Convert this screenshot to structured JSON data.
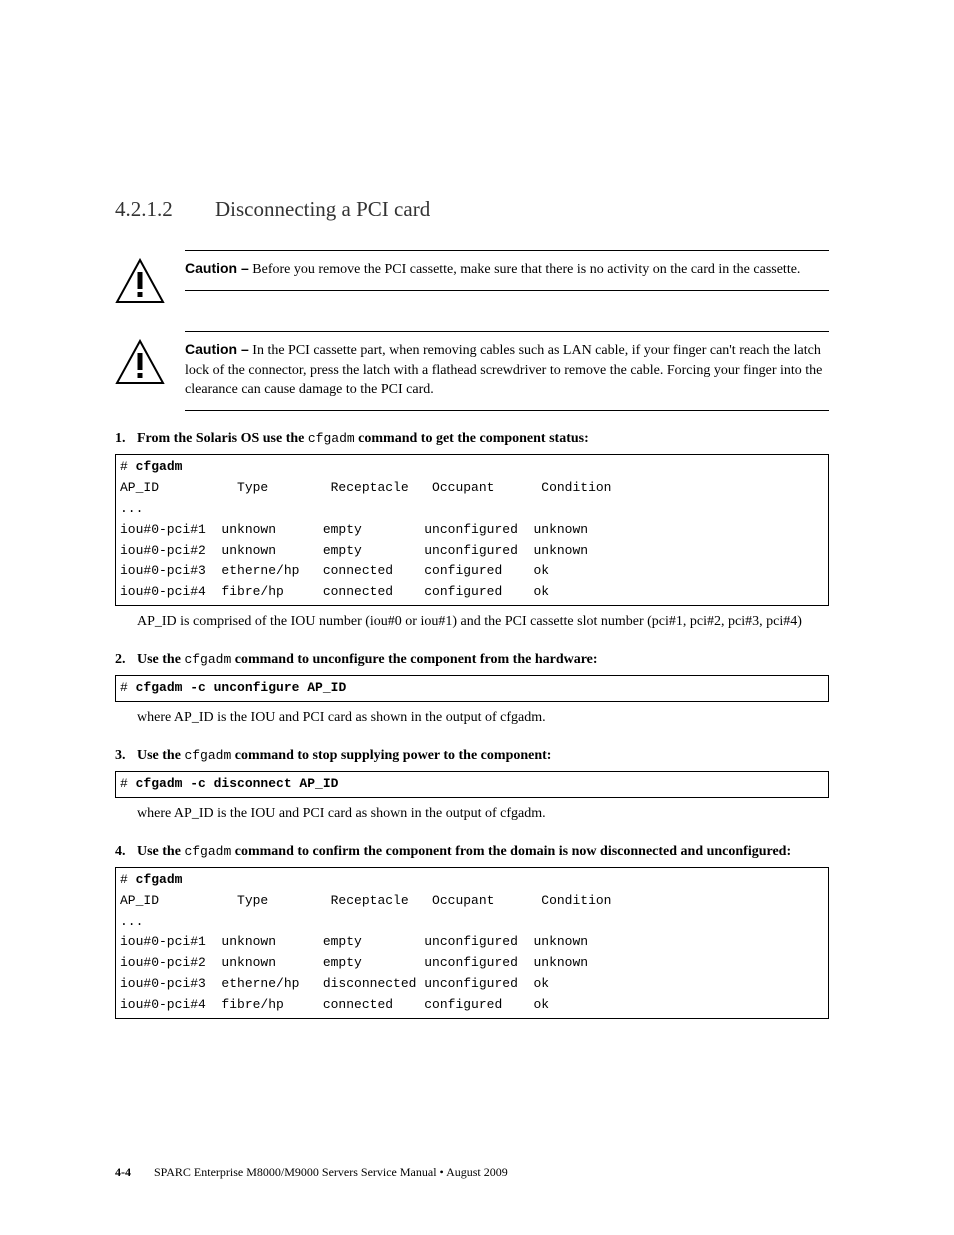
{
  "section": {
    "number": "4.2.1.2",
    "title": "Disconnecting a PCI card"
  },
  "cautions": [
    {
      "label": "Caution –",
      "text": "Before you remove the PCI cassette, make sure that there is no activity on the card in the cassette."
    },
    {
      "label": "Caution –",
      "text": "In the PCI cassette part, when removing cables such as LAN cable, if your finger can't reach the latch lock of the connector, press the latch with a flathead screwdriver to remove the cable. Forcing your finger into the clearance can cause damage to the PCI card."
    }
  ],
  "steps": [
    {
      "num": "1.",
      "pre": "From the Solaris OS use the ",
      "cmd": "cfgadm",
      "post": " command to get the component status:"
    },
    {
      "num": "2.",
      "pre": "Use the ",
      "cmd": "cfgadm",
      "post": " command to unconfigure the component from the hardware:"
    },
    {
      "num": "3.",
      "pre": "Use the ",
      "cmd": "cfgadm",
      "post": " command to stop supplying power to the component:"
    },
    {
      "num": "4.",
      "pre": "Use the ",
      "cmd": "cfgadm",
      "post": " command to confirm the component from the domain is now disconnected and unconfigured:"
    }
  ],
  "code1": {
    "prompt": "# ",
    "cmd": "cfgadm",
    "header": "AP_ID          Type        Receptacle   Occupant      Condition",
    "ellipsis": "...",
    "rows": [
      "iou#0-pci#1  unknown      empty        unconfigured  unknown",
      "iou#0-pci#2  unknown      empty        unconfigured  unknown",
      "iou#0-pci#3  etherne/hp   connected    configured    ok",
      "iou#0-pci#4  fibre/hp     connected    configured    ok"
    ]
  },
  "note1": "AP_ID is comprised of the IOU number (iou#0 or iou#1) and the PCI cassette slot number (pci#1, pci#2, pci#3, pci#4)",
  "code2": {
    "prompt": "# ",
    "cmd": "cfgadm -c unconfigure AP_ID"
  },
  "note2": "where AP_ID is the IOU and PCI card as shown in the output of cfgadm.",
  "code3": {
    "prompt": "# ",
    "cmd": "cfgadm -c disconnect AP_ID"
  },
  "note3": "where AP_ID is the IOU and PCI card as shown in the output of cfgadm.",
  "code4": {
    "prompt": "# ",
    "cmd": "cfgadm",
    "header": "AP_ID          Type        Receptacle   Occupant      Condition",
    "ellipsis": "...",
    "rows": [
      "iou#0-pci#1  unknown      empty        unconfigured  unknown",
      "iou#0-pci#2  unknown      empty        unconfigured  unknown",
      "iou#0-pci#3  etherne/hp   disconnected unconfigured  ok",
      "iou#0-pci#4  fibre/hp     connected    configured    ok"
    ]
  },
  "footer": {
    "page": "4-4",
    "title": "SPARC Enterprise M8000/M9000 Servers Service Manual • August 2009"
  }
}
